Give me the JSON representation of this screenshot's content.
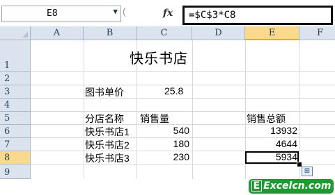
{
  "formula_bar": {
    "name_box": "E8",
    "dropdown": "▼",
    "paren": "(",
    "fx": "fx",
    "formula": "=$C$3*C8"
  },
  "columns": [
    "A",
    "B",
    "C",
    "D",
    "E",
    "F"
  ],
  "rows": [
    "1",
    "2",
    "3",
    "4",
    "5",
    "6",
    "7",
    "8",
    "9"
  ],
  "selected": {
    "column": "E",
    "row": "8"
  },
  "cells": {
    "B1": "快乐书店",
    "B3": "图书单价",
    "C3": "25.8",
    "B5": "分店名称",
    "C5": "销售量",
    "E5": "销售总额",
    "B6": "快乐书店1",
    "C6": "540",
    "E6": "13932",
    "B7": "快乐书店2",
    "C7": "180",
    "E7": "4644",
    "B8": "快乐书店3",
    "C8": "230",
    "E8": "5934"
  },
  "watermark": {
    "letter": "E",
    "text": "Excelcn.com",
    "color": "#1f9a30"
  }
}
